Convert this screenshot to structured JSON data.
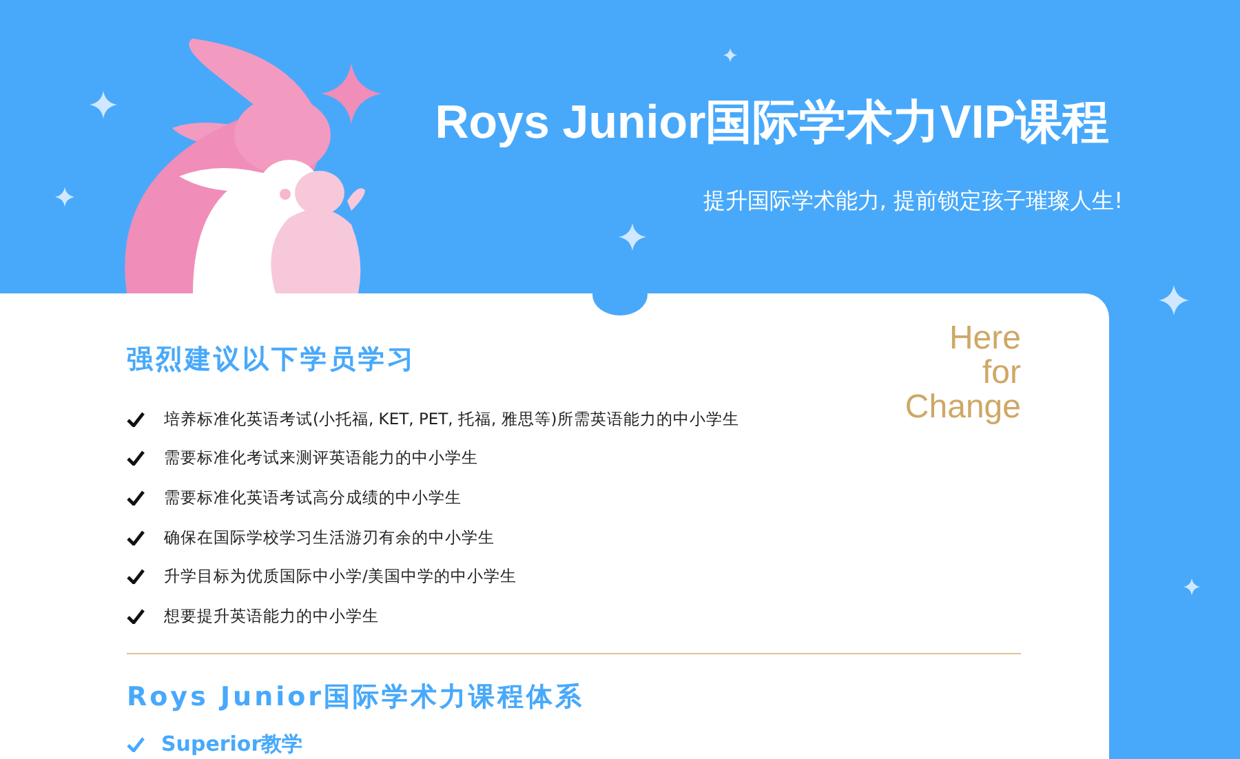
{
  "header": {
    "title": "Roys Junior国际学术力VIP课程",
    "subtitle": "提升国际学术能力, 提前锁定孩子璀璨人生!"
  },
  "slogan": [
    "Here",
    "for",
    "Change"
  ],
  "recommend": {
    "heading": "强烈建议以下学员学习",
    "items": [
      {
        "text": "培养标准化英语考试(小托福, KET, PET, 托福, 雅思等)所需英语能力的中小学生",
        "checked": true
      },
      {
        "text": "需要标准化考试来测评英语能力的中小学生",
        "checked": true
      },
      {
        "text": "需要标准化英语考试高分成绩的中小学生",
        "checked": true
      },
      {
        "text": "确保在国际学校学习生活游刃有余的中小学生",
        "checked": true
      },
      {
        "text": "升学目标为优质国际中小学/美国中学的中小学生",
        "checked": true
      },
      {
        "text": "想要提升英语能力的中小学生",
        "checked": true
      }
    ]
  },
  "system": {
    "heading": "Roys Junior国际学术力课程体系",
    "items": [
      {
        "text": "Superior教学"
      }
    ]
  }
}
